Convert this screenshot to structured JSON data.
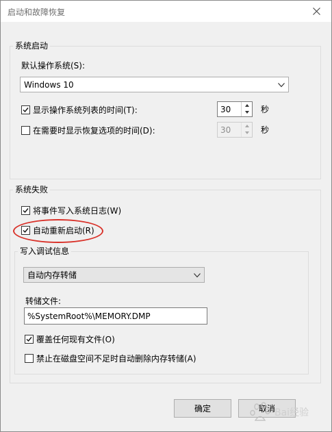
{
  "window": {
    "title": "启动和故障恢复"
  },
  "system_startup": {
    "legend": "系统启动",
    "default_os_label": "默认操作系统(S):",
    "default_os_value": "Windows 10",
    "show_list": {
      "label": "显示操作系统列表的时间(T):",
      "checked": true,
      "value": "30",
      "unit": "秒"
    },
    "show_recovery": {
      "label": "在需要时显示恢复选项的时间(D):",
      "checked": false,
      "value": "30",
      "unit": "秒"
    }
  },
  "system_failure": {
    "legend": "系统失败",
    "write_event": {
      "label": "将事件写入系统日志(W)",
      "checked": true
    },
    "auto_restart": {
      "label": "自动重新启动(R)",
      "checked": true
    },
    "debug": {
      "legend": "写入调试信息",
      "dump_type": "自动内存转储",
      "dump_file_label": "转储文件:",
      "dump_file_value": "%SystemRoot%\\MEMORY.DMP",
      "overwrite": {
        "label": "覆盖任何现有文件(O)",
        "checked": true
      },
      "disable_auto_delete": {
        "label": "禁止在磁盘空间不足时自动删除内存转储(A)",
        "checked": false
      }
    }
  },
  "buttons": {
    "ok": "确定",
    "cancel": "取消"
  },
  "colors": {
    "highlight_ellipse": "#d9322a",
    "dialog_bg": "#f0f0f0"
  },
  "watermark": {
    "text": "Bai经验"
  }
}
